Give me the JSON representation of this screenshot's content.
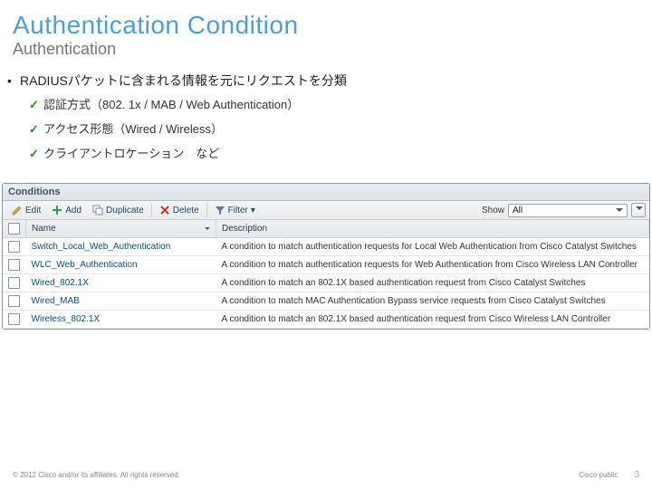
{
  "title": "Authentication Condition",
  "subtitle": "Authentication",
  "main_bullet": "RADIUSパケットに含まれる情報を元にリクエストを分類",
  "checks": [
    "認証方式（802. 1x / MAB / Web Authentication）",
    "アクセス形態（Wired / Wireless）",
    "クライアントロケーション　など"
  ],
  "panel": {
    "header": "Conditions",
    "toolbar": {
      "edit": "Edit",
      "add": "Add",
      "duplicate": "Duplicate",
      "delete": "Delete",
      "filter": "Filter",
      "show_label": "Show",
      "show_value": "All"
    },
    "columns": {
      "name": "Name",
      "description": "Description"
    },
    "rows": [
      {
        "name": "Switch_Local_Web_Authentication",
        "desc": "A condition to match authentication requests for Local Web Authentication from Cisco Catalyst Switches"
      },
      {
        "name": "WLC_Web_Authentication",
        "desc": "A condition to match authentication requests for Web Authentication from Cisco Wireless LAN Controller"
      },
      {
        "name": "Wired_802.1X",
        "desc": "A condition to match an 802.1X based authentication request from Cisco Catalyst Switches"
      },
      {
        "name": "Wired_MAB",
        "desc": "A condition to match MAC Authentication Bypass service requests from Cisco Catalyst Switches"
      },
      {
        "name": "Wireless_802.1X",
        "desc": "A condition to match an 802.1X based authentication request from Cisco Wireless LAN Controller"
      }
    ]
  },
  "footer": {
    "copyright": "© 2012 Cisco and/or its affiliates. All rights reserved.",
    "label": "Cisco public",
    "page": "3"
  }
}
